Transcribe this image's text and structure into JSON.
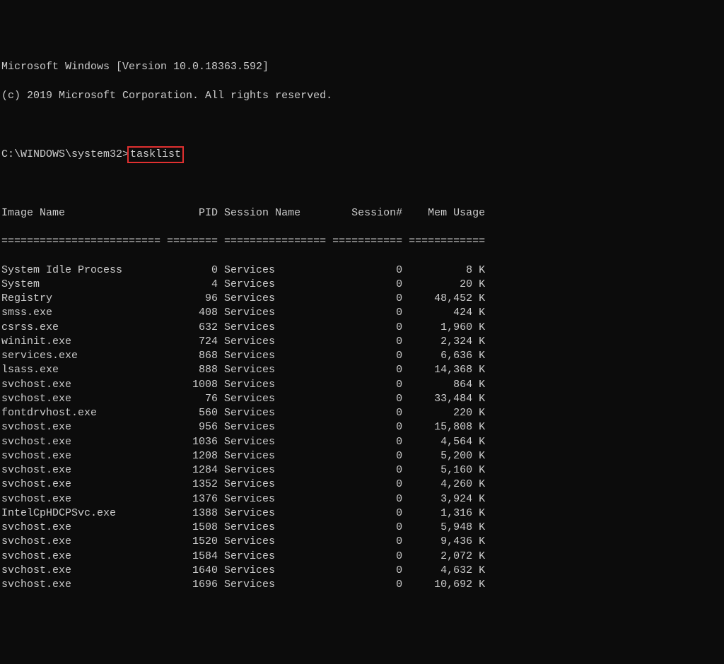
{
  "header": {
    "line1": "Microsoft Windows [Version 10.0.18363.592]",
    "line2": "(c) 2019 Microsoft Corporation. All rights reserved."
  },
  "prompt": {
    "path": "C:\\WINDOWS\\system32>",
    "command": "tasklist"
  },
  "columns": {
    "image_name": "Image Name",
    "pid": "PID",
    "session_name": "Session Name",
    "session_num": "Session#",
    "mem_usage": "Mem Usage"
  },
  "separator": {
    "image_name": "=========================",
    "pid": "========",
    "session_name": "================",
    "session_num": "===========",
    "mem_usage": "============"
  },
  "processes": [
    {
      "image_name": "System Idle Process",
      "pid": 0,
      "session_name": "Services",
      "session_num": 0,
      "mem_usage": "8 K"
    },
    {
      "image_name": "System",
      "pid": 4,
      "session_name": "Services",
      "session_num": 0,
      "mem_usage": "20 K"
    },
    {
      "image_name": "Registry",
      "pid": 96,
      "session_name": "Services",
      "session_num": 0,
      "mem_usage": "48,452 K"
    },
    {
      "image_name": "smss.exe",
      "pid": 408,
      "session_name": "Services",
      "session_num": 0,
      "mem_usage": "424 K"
    },
    {
      "image_name": "csrss.exe",
      "pid": 632,
      "session_name": "Services",
      "session_num": 0,
      "mem_usage": "1,960 K"
    },
    {
      "image_name": "wininit.exe",
      "pid": 724,
      "session_name": "Services",
      "session_num": 0,
      "mem_usage": "2,324 K"
    },
    {
      "image_name": "services.exe",
      "pid": 868,
      "session_name": "Services",
      "session_num": 0,
      "mem_usage": "6,636 K"
    },
    {
      "image_name": "lsass.exe",
      "pid": 888,
      "session_name": "Services",
      "session_num": 0,
      "mem_usage": "14,368 K"
    },
    {
      "image_name": "svchost.exe",
      "pid": 1008,
      "session_name": "Services",
      "session_num": 0,
      "mem_usage": "864 K"
    },
    {
      "image_name": "svchost.exe",
      "pid": 76,
      "session_name": "Services",
      "session_num": 0,
      "mem_usage": "33,484 K"
    },
    {
      "image_name": "fontdrvhost.exe",
      "pid": 560,
      "session_name": "Services",
      "session_num": 0,
      "mem_usage": "220 K"
    },
    {
      "image_name": "svchost.exe",
      "pid": 956,
      "session_name": "Services",
      "session_num": 0,
      "mem_usage": "15,808 K"
    },
    {
      "image_name": "svchost.exe",
      "pid": 1036,
      "session_name": "Services",
      "session_num": 0,
      "mem_usage": "4,564 K"
    },
    {
      "image_name": "svchost.exe",
      "pid": 1208,
      "session_name": "Services",
      "session_num": 0,
      "mem_usage": "5,200 K"
    },
    {
      "image_name": "svchost.exe",
      "pid": 1284,
      "session_name": "Services",
      "session_num": 0,
      "mem_usage": "5,160 K"
    },
    {
      "image_name": "svchost.exe",
      "pid": 1352,
      "session_name": "Services",
      "session_num": 0,
      "mem_usage": "4,260 K"
    },
    {
      "image_name": "svchost.exe",
      "pid": 1376,
      "session_name": "Services",
      "session_num": 0,
      "mem_usage": "3,924 K"
    },
    {
      "image_name": "IntelCpHDCPSvc.exe",
      "pid": 1388,
      "session_name": "Services",
      "session_num": 0,
      "mem_usage": "1,316 K"
    },
    {
      "image_name": "svchost.exe",
      "pid": 1508,
      "session_name": "Services",
      "session_num": 0,
      "mem_usage": "5,948 K"
    },
    {
      "image_name": "svchost.exe",
      "pid": 1520,
      "session_name": "Services",
      "session_num": 0,
      "mem_usage": "9,436 K"
    },
    {
      "image_name": "svchost.exe",
      "pid": 1584,
      "session_name": "Services",
      "session_num": 0,
      "mem_usage": "2,072 K"
    },
    {
      "image_name": "svchost.exe",
      "pid": 1640,
      "session_name": "Services",
      "session_num": 0,
      "mem_usage": "4,632 K"
    },
    {
      "image_name": "svchost.exe",
      "pid": 1696,
      "session_name": "Services",
      "session_num": 0,
      "mem_usage": "10,692 K"
    }
  ],
  "widths": {
    "image_name": 25,
    "pid": 8,
    "session_name": 16,
    "session_num": 11,
    "mem_usage": 12
  }
}
